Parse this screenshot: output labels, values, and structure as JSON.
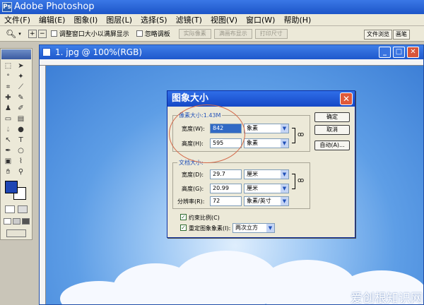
{
  "app": {
    "title": "Adobe Photoshop",
    "icon_glyph": "Ps"
  },
  "menu": [
    "文件(F)",
    "编辑(E)",
    "图象(I)",
    "图层(L)",
    "选择(S)",
    "滤镜(T)",
    "视图(V)",
    "窗口(W)",
    "帮助(H)"
  ],
  "options_bar": {
    "resize_window_label": "调整窗口大小以满屏显示",
    "ignore_palettes_label": "忽略调板",
    "btn_actual_pixels": "实际像素",
    "btn_fit_screen": "满画布显示",
    "btn_print_size": "打印尺寸"
  },
  "palette_tabs": [
    "文件浏览",
    "画笔"
  ],
  "document": {
    "title": "1. jpg @ 100%(RGB)"
  },
  "dialog": {
    "title": "图象大小",
    "pixel_group": {
      "label": "像素大小:1.43M",
      "width_label": "宽度(W):",
      "width_value": "842",
      "width_unit": "象素",
      "height_label": "高度(H):",
      "height_value": "595",
      "height_unit": "象素"
    },
    "doc_group": {
      "label": "文档大小:",
      "width_label": "宽度(D):",
      "width_value": "29.7",
      "width_unit": "厘米",
      "height_label": "高度(G):",
      "height_value": "20.99",
      "height_unit": "厘米",
      "res_label": "分辨率(R):",
      "res_value": "72",
      "res_unit": "象素/英寸"
    },
    "constrain_label": "约束比例(C)",
    "resample_label": "重定图象象素(I):",
    "resample_method": "两次立方",
    "ok": "确定",
    "cancel": "取消",
    "auto": "自动(A)..."
  },
  "watermark": "爱创根知识网"
}
